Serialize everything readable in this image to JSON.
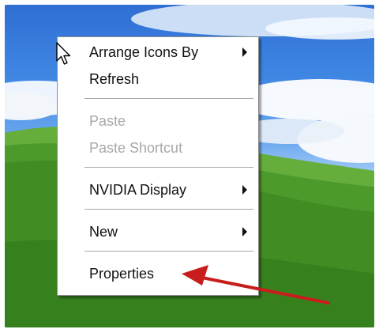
{
  "context_menu": {
    "items": [
      {
        "label": "Arrange Icons By",
        "has_submenu": true,
        "enabled": true
      },
      {
        "label": "Refresh",
        "has_submenu": false,
        "enabled": true
      },
      {
        "label": "Paste",
        "has_submenu": false,
        "enabled": false
      },
      {
        "label": "Paste Shortcut",
        "has_submenu": false,
        "enabled": false
      },
      {
        "label": "NVIDIA Display",
        "has_submenu": true,
        "enabled": true
      },
      {
        "label": "New",
        "has_submenu": true,
        "enabled": true
      },
      {
        "label": "Properties",
        "has_submenu": false,
        "enabled": true
      }
    ]
  },
  "colors": {
    "annotation_arrow": "#c81d1d",
    "disabled_text": "#a8a8a8",
    "menu_border": "#8b8b8b"
  },
  "icons": [
    "mouse-pointer-icon",
    "submenu-arrow-icon",
    "annotation-arrow-icon"
  ]
}
